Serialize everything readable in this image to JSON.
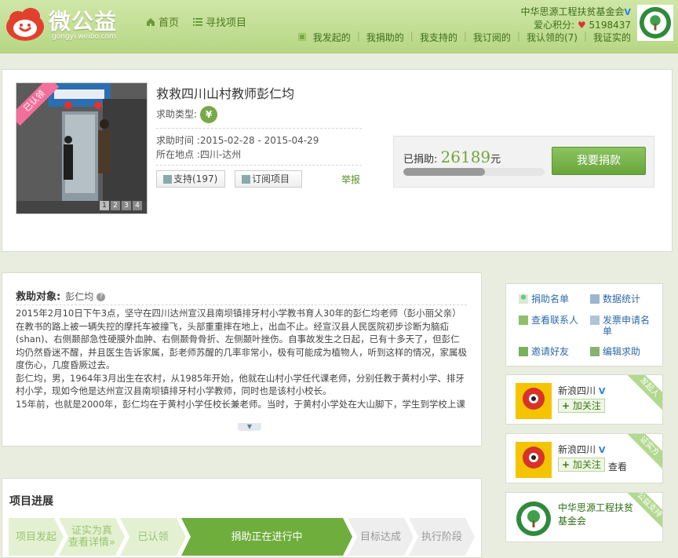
{
  "header": {
    "logo_text": "微公益",
    "logo_sub": "gongyi.weibo.com",
    "nav": [
      {
        "label": "首页",
        "icon": "home-icon"
      },
      {
        "label": "寻找项目",
        "icon": "list-icon"
      }
    ],
    "org_name": "中华思源工程扶贫基金会",
    "love_label": "爱心积分:",
    "love_value": "5198437",
    "menu": [
      "我发起的",
      "我捐助的",
      "我支持的",
      "我订阅的",
      "我认领的(7)",
      "我证实的"
    ]
  },
  "project": {
    "ribbon": "已认领",
    "thumb_pages": [
      "1",
      "2",
      "3",
      "4"
    ],
    "title": "救救四川山村教师彭仁均",
    "type_label": "求助类型:",
    "type_icon": "¥",
    "time_label": "求助时间",
    "time_value": ":2015-02-28 - 2015-04-29",
    "place_label": "所在地点",
    "place_value": ":四川-达州",
    "support_label": "支持(197)",
    "subscribe_label": "订阅项目",
    "report_label": "举报",
    "donated_label": "已捐助:",
    "donated_value": "26189",
    "donated_unit": "元",
    "progress_ratio": 0.58,
    "donate_button": "我要捐款"
  },
  "description": {
    "heading": "救助对象:",
    "recipient": "彭仁均",
    "paragraphs": [
      "2015年2月10日下午3点，坚守在四川达州宣汉县南坝镇排牙村小学教书育人30年的彭仁均老师（彭小丽父亲）在教书的路上被一辆失控的摩托车被撞飞，头部重重摔在地上，出血不止。经宣汉县人民医院初步诊断为脑疝(shan)、右侧颞部急性硬膜外血肿、右侧颞骨骨折、左侧颞叶挫伤。自事故发生之日起，已有十多天了，但彭仁均仍然昏迷不醒，并且医生告诉家属，彭老师苏醒的几率非常小，极有可能成为植物人，听到这样的情况，家属极度伤心，几度昏厥过去。",
      "彭仁均，男，1964年3月出生在农村，从1985年开始，他就在山村小学任代课老师，分别任教于黄村小学、排牙村小学，现如今他是达州宣汉县南坝镇排牙村小学教师，同时也是该村小校长。",
      "15年前，也就是2000年，彭仁均在于黄村小学任校长兼老师。当时，于黄村小学处在大山脚下，学生到学校上课"
    ]
  },
  "stages": {
    "title": "项目进展",
    "items": [
      {
        "label": "项目发起",
        "state": "done"
      },
      {
        "label": "证实为真",
        "sub": "查看详情»",
        "state": "done"
      },
      {
        "label": "已认领",
        "state": "done"
      },
      {
        "label": "捐助正在进行中",
        "state": "active"
      },
      {
        "label": "目标达成",
        "state": "todo"
      },
      {
        "label": "执行阶段",
        "state": "todo"
      }
    ]
  },
  "sidebar": {
    "actions": [
      {
        "label": "捐助名单",
        "icon": "donor-list-icon"
      },
      {
        "label": "数据统计",
        "icon": "stats-icon"
      },
      {
        "label": "查看联系人",
        "icon": "contact-icon"
      },
      {
        "label": "发票申请名单",
        "icon": "invoice-icon"
      },
      {
        "label": "邀请好友",
        "icon": "invite-icon"
      },
      {
        "label": "编辑求助",
        "icon": "edit-icon"
      }
    ],
    "people": [
      {
        "name": "新浪四川",
        "follow": "加关注",
        "tag": "发起人",
        "extra": ""
      },
      {
        "name": "新浪四川",
        "follow": "加关注",
        "tag": "证实方",
        "extra": "查看"
      },
      {
        "name": "中华思源工程扶贫基金会",
        "follow": "",
        "tag": "公益支持",
        "extra": ""
      }
    ]
  },
  "colors": {
    "accent": "#6fae3d",
    "link": "#2e6aa8",
    "header": "#c3de96"
  }
}
